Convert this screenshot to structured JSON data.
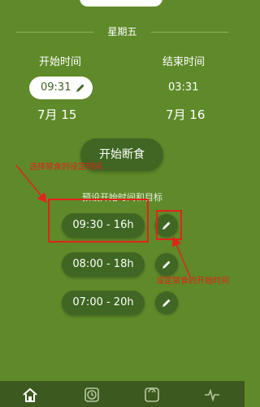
{
  "header": {
    "weekday": "星期五"
  },
  "start": {
    "title": "开始时间",
    "time": "09:31",
    "date": "7月 15"
  },
  "end": {
    "title": "结束时间",
    "time": "03:31",
    "date": "7月 16"
  },
  "actions": {
    "start_fast_label": "开始断食"
  },
  "presets": {
    "title": "预设开始时间和目标",
    "items": [
      {
        "label": "09:30 - 16h"
      },
      {
        "label": "08:00 - 18h"
      },
      {
        "label": "07:00 - 20h"
      }
    ]
  },
  "annotations": {
    "select_note": "选择禁食的设定时间",
    "set_start_note": "设定禁食的开始时间"
  },
  "tabbar": {
    "items": [
      "home-icon",
      "clock-icon",
      "scale-icon",
      "pulse-icon"
    ]
  },
  "colors": {
    "background": "#5f8a2a",
    "pill_dark": "#3f6622",
    "annotation": "#e2231a",
    "tabbar": "#3c5a1f"
  }
}
